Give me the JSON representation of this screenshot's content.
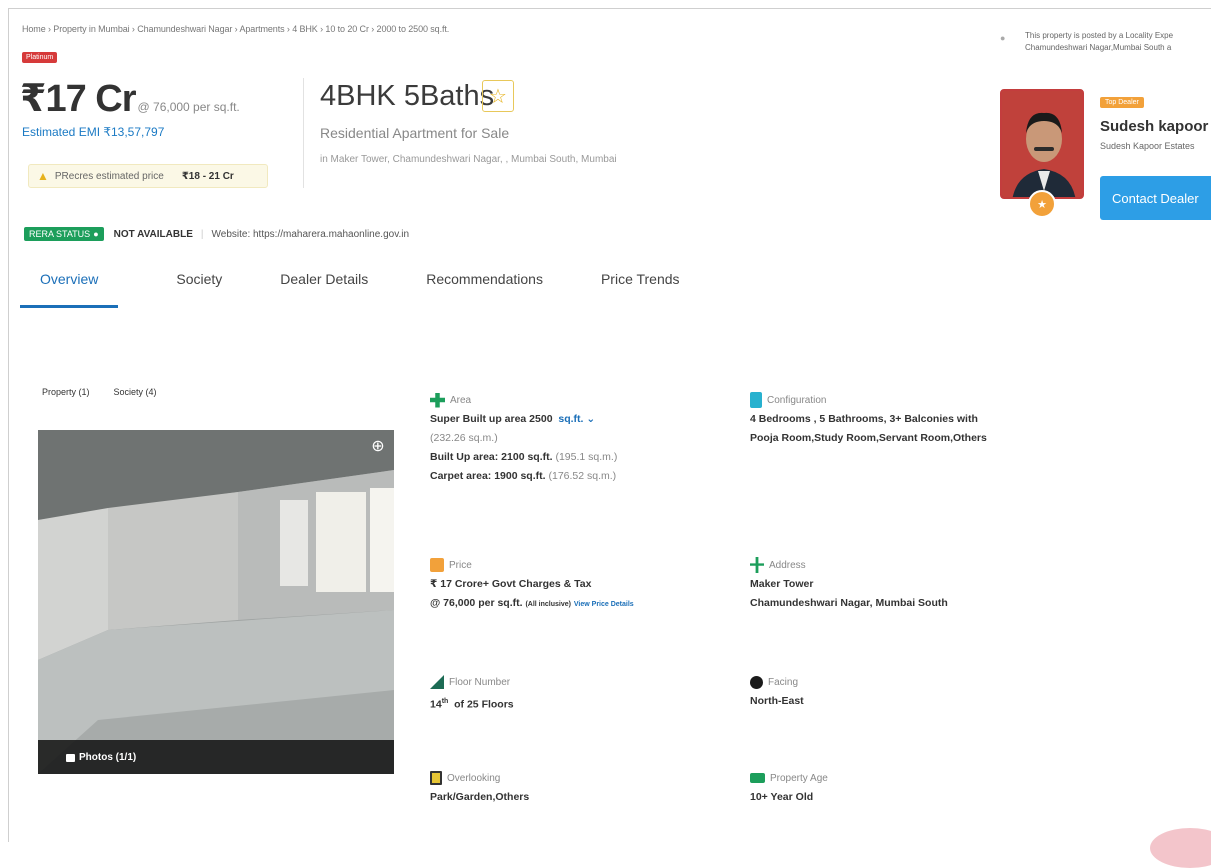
{
  "breadcrumb": "Home › Property in Mumbai › Chamundeshwari Nagar › Apartments › 4 BHK › 10 to 20 Cr › 2000 to 2500 sq.ft.",
  "badge": "Platinum",
  "price": {
    "main": "₹17 Cr",
    "rate": "@ 76,000 per sq.ft.",
    "emi": "Estimated EMI ₹13,57,797",
    "estimate_label": "PRecres estimated price",
    "estimate_range": "₹18 - 21 Cr"
  },
  "property": {
    "title": "4BHK 5Baths",
    "subtitle": "Residential Apartment for Sale",
    "location": "in Maker Tower, Chamundeshwari Nagar, , Mumbai South, Mumbai"
  },
  "rera": {
    "tag": "RERA STATUS",
    "status": "NOT AVAILABLE",
    "website": "Website: https://maharera.mahaonline.gov.in"
  },
  "tabs": [
    "Overview",
    "Society",
    "Dealer Details",
    "Recommendations",
    "Price Trends"
  ],
  "dealer": {
    "posted_line1": "This property is posted by a Locality Expe",
    "posted_line2": "Chamundeshwari Nagar,Mumbai South a",
    "badge": "Top Dealer",
    "name": "Sudesh kapoor",
    "firm": "Sudesh Kapoor Estates",
    "contact_label": "Contact Dealer"
  },
  "subtabs": [
    "Property (1)",
    "Society (4)"
  ],
  "photo": {
    "count_label": "Photos (1/1)"
  },
  "details": {
    "area": {
      "label": "Area",
      "super_label": "Super Built up area 2500",
      "super_unit": "sq.ft.",
      "super_conv": "(232.26 sq.m.)",
      "built": "Built Up area: 2100 sq.ft.",
      "built_conv": "(195.1 sq.m.)",
      "carpet": "Carpet area: 1900 sq.ft.",
      "carpet_conv": "(176.52 sq.m.)"
    },
    "configuration": {
      "label": "Configuration",
      "line1": "4 Bedrooms , 5 Bathrooms, 3+ Balconies with",
      "line2": "Pooja Room,Study Room,Servant Room,Others"
    },
    "price": {
      "label": "Price",
      "line1": "₹ 17 Crore+ Govt Charges & Tax",
      "line2": "@ 76,000 per sq.ft.",
      "inclusive": "(All inclusive)",
      "link": "View Price Details"
    },
    "address": {
      "label": "Address",
      "line1": "Maker Tower",
      "line2": "Chamundeshwari Nagar, Mumbai South"
    },
    "floor": {
      "label": "Floor Number",
      "value_num": "14",
      "value_sup": "th",
      "value_rest": "of 25 Floors"
    },
    "facing": {
      "label": "Facing",
      "value": "North-East"
    },
    "overlooking": {
      "label": "Overlooking",
      "value": "Park/Garden,Others"
    },
    "age": {
      "label": "Property Age",
      "value": "10+ Year Old"
    }
  },
  "icons": {
    "star": "star-icon",
    "zoom": "zoom-icon",
    "camera": "photo-icon"
  },
  "colors": {
    "accent_blue": "#1b6fb8",
    "rera_green": "#1c9e5b",
    "platinum_red": "#d63a3a",
    "contact_blue": "#2d9ee6",
    "dealer_orange": "#f2a13a"
  }
}
